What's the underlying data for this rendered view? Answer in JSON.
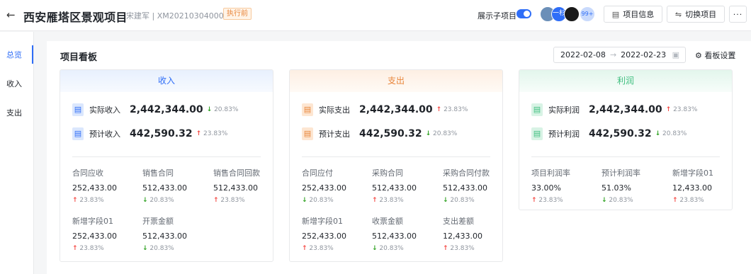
{
  "header": {
    "title": "西安雁塔区景观项目",
    "meta": "宋建军 | XM202103040001",
    "status": "执行前",
    "toggle_label": "展示子项目",
    "avatars": [
      "",
      "一杉",
      "",
      "99+"
    ],
    "btn_info": "项目信息",
    "btn_switch": "切换项目",
    "btn_more": "···"
  },
  "sidebar": {
    "items": [
      {
        "label": "总览",
        "active": true
      },
      {
        "label": "收入",
        "active": false
      },
      {
        "label": "支出",
        "active": false
      }
    ]
  },
  "board": {
    "title": "项目看板",
    "date_start": "2022-02-08",
    "date_sep": "→",
    "date_end": "2022-02-23",
    "settings": "看板设置"
  },
  "cards": [
    {
      "title": "收入",
      "primary": [
        {
          "label": "实际收入",
          "value": "2,442,344.00",
          "dir": "down",
          "pct": "20.83%"
        },
        {
          "label": "预计收入",
          "value": "442,590.32",
          "dir": "up",
          "pct": "23.83%"
        }
      ],
      "cells": [
        {
          "label": "合同应收",
          "value": "252,433.00",
          "dir": "up",
          "pct": "23.83%"
        },
        {
          "label": "销售合同",
          "value": "512,433.00",
          "dir": "down",
          "pct": "20.83%"
        },
        {
          "label": "销售合同回款",
          "value": "512,433.00",
          "dir": "up",
          "pct": "23.83%"
        },
        {
          "label": "新增字段01",
          "value": "252,433.00",
          "dir": "up",
          "pct": "23.83%"
        },
        {
          "label": "开票金额",
          "value": "512,433.00",
          "dir": "down",
          "pct": "20.83%"
        }
      ]
    },
    {
      "title": "支出",
      "primary": [
        {
          "label": "实际支出",
          "value": "2,442,344.00",
          "dir": "up",
          "pct": "23.83%"
        },
        {
          "label": "预计支出",
          "value": "442,590.32",
          "dir": "down",
          "pct": "20.83%"
        }
      ],
      "cells": [
        {
          "label": "合同应付",
          "value": "252,433.00",
          "dir": "down",
          "pct": "20.83%"
        },
        {
          "label": "采购合同",
          "value": "512,433.00",
          "dir": "up",
          "pct": "23.83%"
        },
        {
          "label": "采购合同付款",
          "value": "512,433.00",
          "dir": "down",
          "pct": "20.83%"
        },
        {
          "label": "新增字段01",
          "value": "252,433.00",
          "dir": "up",
          "pct": "23.83%"
        },
        {
          "label": "收票金额",
          "value": "512,433.00",
          "dir": "down",
          "pct": "20.83%"
        },
        {
          "label": "支出差额",
          "value": "12,433.00",
          "dir": "up",
          "pct": "23.83%"
        }
      ]
    },
    {
      "title": "利润",
      "primary": [
        {
          "label": "实际利润",
          "value": "2,442,344.00",
          "dir": "up",
          "pct": "23.83%"
        },
        {
          "label": "预计利润",
          "value": "442,590.32",
          "dir": "down",
          "pct": "20.83%"
        }
      ],
      "cells": [
        {
          "label": "项目利润率",
          "value": "33.00%",
          "dir": "up",
          "pct": "23.83%"
        },
        {
          "label": "预计利润率",
          "value": "51.03%",
          "dir": "down",
          "pct": "20.83%"
        },
        {
          "label": "新增字段01",
          "value": "12,433.00",
          "dir": "up",
          "pct": "23.83%"
        }
      ]
    }
  ],
  "colors": {
    "accent": "#2f6ef7",
    "up": "#f54a45",
    "down": "#2ea121",
    "income": "#2f6ef7",
    "expense": "#e8853a",
    "profit": "#3fbf7f"
  }
}
